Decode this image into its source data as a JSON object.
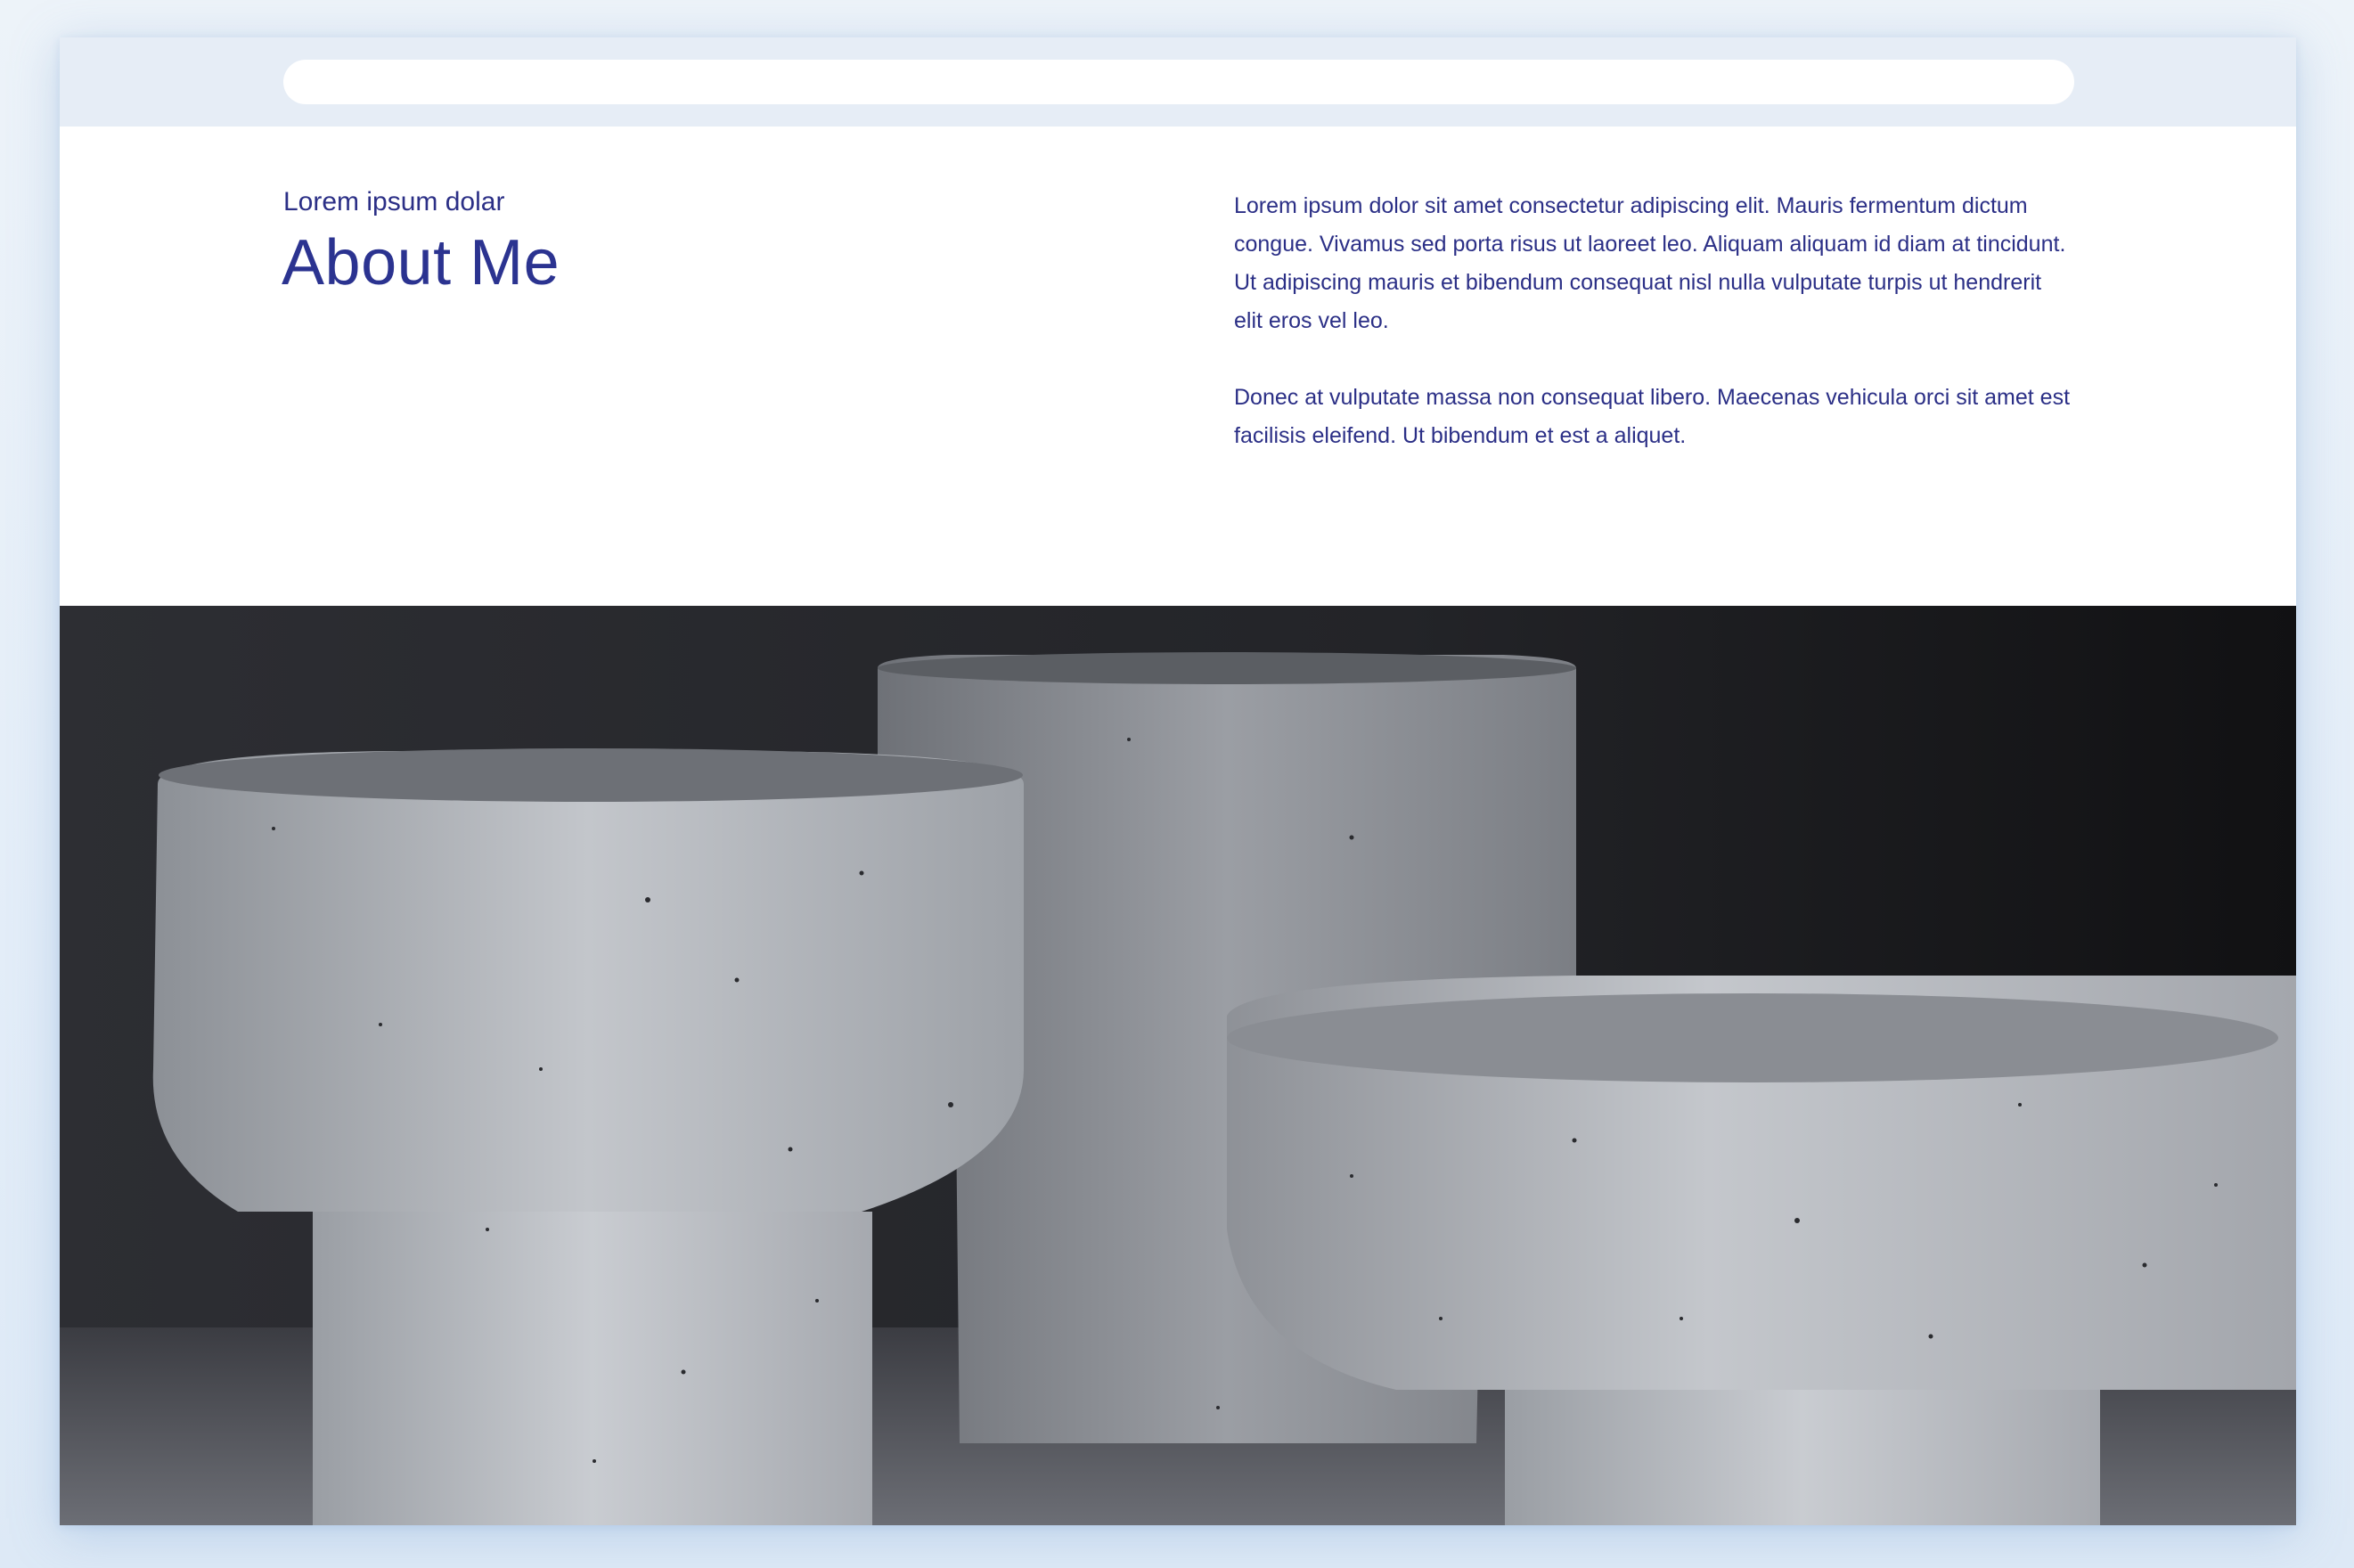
{
  "browser": {
    "address_value": ""
  },
  "about": {
    "kicker": "Lorem ipsum dolar",
    "title": "About Me",
    "paragraphs": [
      "Lorem ipsum dolor sit amet consectetur adipiscing elit. Mauris fermentum dictum congue. Vivamus sed porta risus ut laoreet leo. Aliquam aliquam id diam at tincidunt. Ut adipiscing mauris et bibendum consequat nisl nulla vulputate turpis ut hendrerit elit eros vel leo.",
      "Donec at vulputate massa non consequat libero. Maecenas vehicula orci sit amet est facilisis eleifend. Ut bibendum et est a aliquet."
    ]
  },
  "colors": {
    "page_background": "#e6edf6",
    "accent_text": "#2b3390",
    "photo_background": "#26272b",
    "pottery": "#b8bcc2"
  }
}
